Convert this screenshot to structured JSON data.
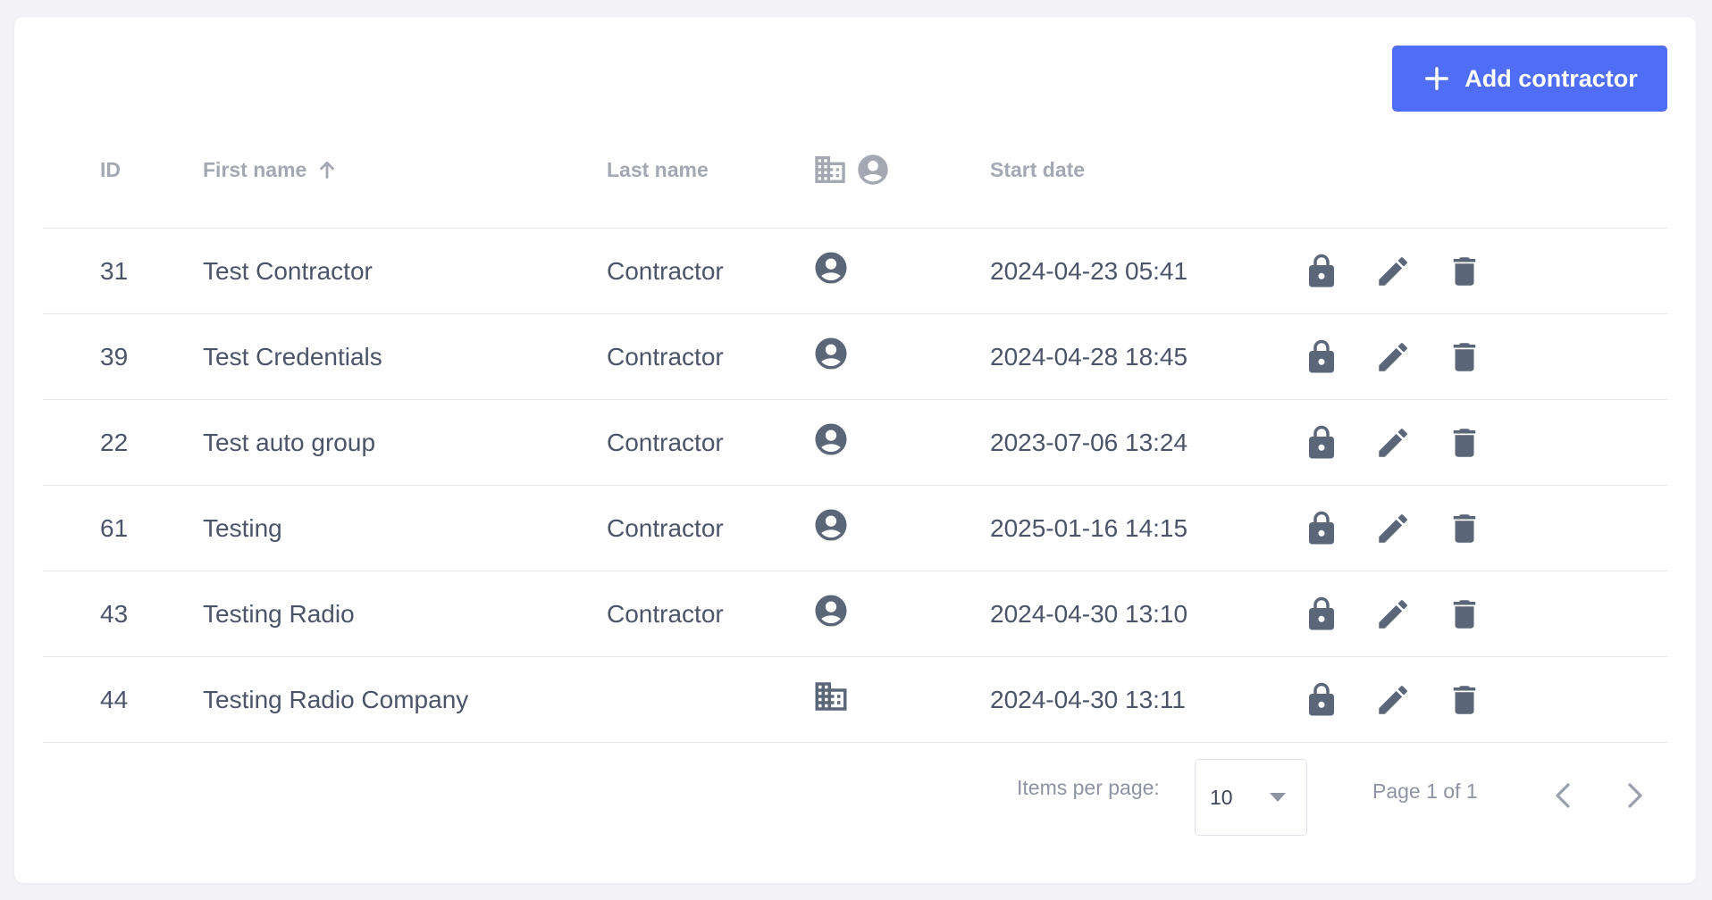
{
  "toolbar": {
    "add_label": "Add contractor",
    "add_icon": "plus-icon"
  },
  "table": {
    "columns": {
      "id": "ID",
      "first_name": "First name",
      "last_name": "Last name",
      "start_date": "Start date"
    },
    "sort": {
      "column": "first_name",
      "direction": "ascending"
    },
    "rows": [
      {
        "id": "31",
        "first_name": "Test Contractor",
        "last_name": "Contractor",
        "type": "person",
        "start_date": "2024-04-23 05:41"
      },
      {
        "id": "39",
        "first_name": "Test Credentials",
        "last_name": "Contractor",
        "type": "person",
        "start_date": "2024-04-28 18:45"
      },
      {
        "id": "22",
        "first_name": "Test auto group",
        "last_name": "Contractor",
        "type": "person",
        "start_date": "2023-07-06 13:24"
      },
      {
        "id": "61",
        "first_name": "Testing",
        "last_name": "Contractor",
        "type": "person",
        "start_date": "2025-01-16 14:15"
      },
      {
        "id": "43",
        "first_name": "Testing Radio",
        "last_name": "Contractor",
        "type": "person",
        "start_date": "2024-04-30 13:10"
      },
      {
        "id": "44",
        "first_name": "Testing Radio Company",
        "last_name": "",
        "type": "company",
        "start_date": "2024-04-30 13:11"
      }
    ]
  },
  "pagination": {
    "items_per_page_label": "Items per page:",
    "items_per_page": "10",
    "page_label": "Page 1 of 1"
  },
  "colors": {
    "accent": "#4f6df5",
    "text": "#4b5468",
    "muted": "#a3a8b3",
    "icon": "#5c6679"
  }
}
